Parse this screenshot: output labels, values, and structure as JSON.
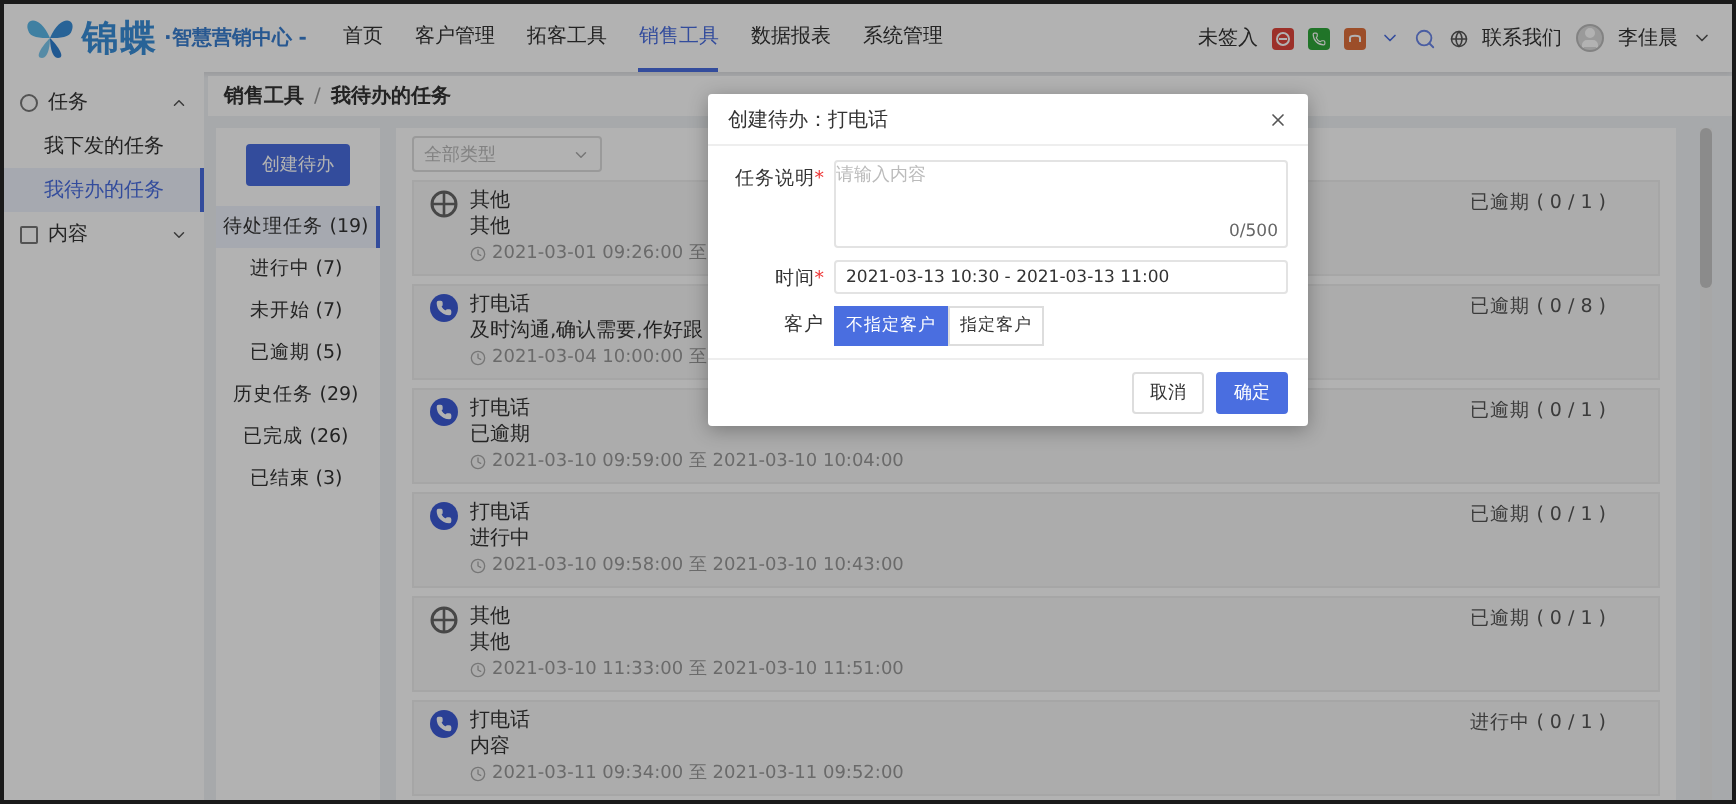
{
  "header": {
    "logo": {
      "brand": "锦蝶",
      "tagline": "·智慧营销中心 -"
    },
    "nav": [
      {
        "label": "首页",
        "selected": false
      },
      {
        "label": "客户管理",
        "selected": false
      },
      {
        "label": "拓客工具",
        "selected": false
      },
      {
        "label": "销售工具",
        "selected": true
      },
      {
        "label": "数据报表",
        "selected": false
      },
      {
        "label": "系统管理",
        "selected": false
      }
    ],
    "sign_status": "未签入",
    "contact": "联系我们",
    "user": "李佳晨"
  },
  "sidebar": {
    "groups": [
      {
        "label": "任务",
        "expanded": true,
        "items": [
          {
            "label": "我下发的任务",
            "selected": false
          },
          {
            "label": "我待办的任务",
            "selected": true
          }
        ]
      },
      {
        "label": "内容",
        "expanded": false
      }
    ]
  },
  "breadcrumb": [
    "销售工具",
    "我待办的任务"
  ],
  "breadcrumb_separator": "/",
  "create_button": "创建待办",
  "type_filter": {
    "placeholder": "全部类型"
  },
  "status_tabs": [
    {
      "label": "待处理任务 (19)",
      "selected": true
    },
    {
      "label": "进行中 (7)",
      "selected": false
    },
    {
      "label": "未开始 (7)",
      "selected": false
    },
    {
      "label": "已逾期 (5)",
      "selected": false
    },
    {
      "label": "历史任务 (29)",
      "selected": false
    },
    {
      "label": "已完成 (26)",
      "selected": false
    },
    {
      "label": "已结束 (3)",
      "selected": false
    }
  ],
  "tasks": [
    {
      "kind": "other",
      "title": "其他",
      "description": "其他",
      "time": "2021-03-01 09:26:00 至",
      "status": "已逾期 ( 0 / 1 )"
    },
    {
      "kind": "call",
      "title": "打电话",
      "description": "及时沟通,确认需要,作好跟",
      "time": "2021-03-04 10:00:00 至",
      "status": "已逾期 ( 0 / 8 )"
    },
    {
      "kind": "call",
      "title": "打电话",
      "description": "已逾期",
      "time": "2021-03-10 09:59:00 至 2021-03-10 10:04:00",
      "status": "已逾期 ( 0 / 1 )"
    },
    {
      "kind": "call",
      "title": "打电话",
      "description": "进行中",
      "time": "2021-03-10 09:58:00 至 2021-03-10 10:43:00",
      "status": "已逾期 ( 0 / 1 )"
    },
    {
      "kind": "other",
      "title": "其他",
      "description": "其他",
      "time": "2021-03-10 11:33:00 至 2021-03-10 11:51:00",
      "status": "已逾期 ( 0 / 1 )"
    },
    {
      "kind": "call",
      "title": "打电话",
      "description": "内容",
      "time": "2021-03-11 09:34:00 至 2021-03-11 09:52:00",
      "status": "进行中 ( 0 / 1 )"
    }
  ],
  "dialog": {
    "title": "创建待办：打电话",
    "required_mark": "*",
    "description": {
      "label": "任务说明",
      "required": true,
      "placeholder": "请输入内容",
      "counter": "0/500"
    },
    "time": {
      "label": "时间",
      "required": true,
      "value": "2021-03-13 10:30 - 2021-03-13 11:00"
    },
    "customer": {
      "label": "客户",
      "options": [
        {
          "label": "不指定客户",
          "selected": true
        },
        {
          "label": "指定客户",
          "selected": false
        }
      ]
    },
    "cancel": "取消",
    "confirm": "确定"
  }
}
